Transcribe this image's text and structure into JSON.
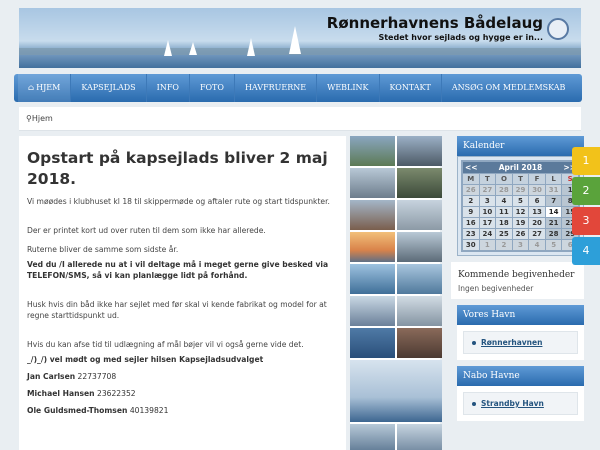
{
  "header": {
    "title": "Rønnerhavnens Bådelaug",
    "tagline": "Stedet hvor sejlads og hygge er in..."
  },
  "nav": {
    "items": [
      {
        "label": "Hjem",
        "icon": "home-icon",
        "active": true
      },
      {
        "label": "Kapsejlads"
      },
      {
        "label": "Info"
      },
      {
        "label": "Foto"
      },
      {
        "label": "Havfruerne"
      },
      {
        "label": "Weblink"
      },
      {
        "label": "Kontakt"
      },
      {
        "label": "Ansøg om medlemskab"
      }
    ]
  },
  "breadcrumb": {
    "icon": "map-marker-icon",
    "label": "Hjem"
  },
  "article": {
    "title": "Opstart på kapsejlads bliver 2 maj 2018.",
    "p1": "Vi møødes i klubhuset kl 18 til skippermøde og aftaler rute og start tidspunkter.",
    "p2": "Der er printet kort ud over ruten til dem som ikke har allerede.",
    "p3": "Ruterne bliver de samme som sidste år.",
    "p4": "Ved du /I allerede nu at i vil deltage må i meget gerne give besked via TELEFON/SMS, så vi kan planlægge lidt på forhånd.",
    "p5": "Husk hvis din båd ikke har sejlet med før skal vi kende fabrikat og model for at regne starttidspunkt ud.",
    "p6": "Hvis du kan afse tid til udlægning af mål bøjer vil vi også gerne vide det.",
    "greeting": "_/)_/) vel mødt og med sejler hilsen Kapsejladsudvalget",
    "contacts": [
      {
        "name": "Jan Carlsen",
        "phone": "22737708"
      },
      {
        "name": "Michael Hansen",
        "phone": "23622352"
      },
      {
        "name": "Ole Guldsmed-Thomsen",
        "phone": "40139821"
      }
    ]
  },
  "sidebar": {
    "calendar": {
      "heading": "Kalender",
      "prev": "<<",
      "next": ">>",
      "month": "April 2018",
      "day_headers": [
        "M",
        "T",
        "O",
        "T",
        "F",
        "L",
        "S"
      ],
      "days": [
        "26",
        "27",
        "28",
        "29",
        "30",
        "31",
        "1",
        "2",
        "3",
        "4",
        "5",
        "6",
        "7",
        "8",
        "9",
        "10",
        "11",
        "12",
        "13",
        "14",
        "15",
        "16",
        "17",
        "18",
        "19",
        "20",
        "21",
        "22",
        "23",
        "24",
        "25",
        "26",
        "27",
        "28",
        "29",
        "30",
        "1",
        "2",
        "3",
        "4",
        "5",
        "6"
      ],
      "today": "14"
    },
    "events": {
      "heading": "Kommende begivenheder",
      "text": "Ingen begivenheder"
    },
    "vores_havn": {
      "heading": "Vores Havn",
      "links": [
        "Rønnerhavnen"
      ]
    },
    "nabo_havne": {
      "heading": "Nabo Havne",
      "links": [
        "Strandby Havn"
      ]
    }
  },
  "side_tabs": [
    {
      "label": "1",
      "color": "#f2c21a"
    },
    {
      "label": "2",
      "color": "#5aa33b"
    },
    {
      "label": "3",
      "color": "#e2473a"
    },
    {
      "label": "4",
      "color": "#2d9fd9"
    }
  ],
  "colors": {
    "nav": "#3a7fc3",
    "accent": "#2a6bae"
  }
}
